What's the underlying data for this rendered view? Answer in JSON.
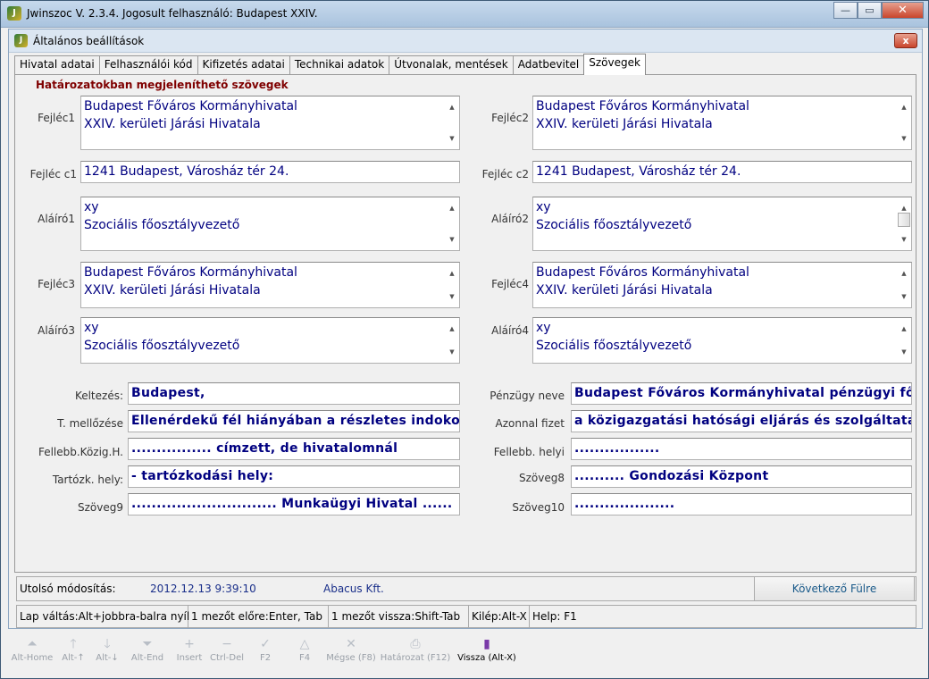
{
  "app": {
    "title": "Jwinszoc V. 2.3.4.  Jogosult felhasználó: Budapest XXIV."
  },
  "window_buttons": {
    "minimize": "—",
    "maximize": "▭",
    "close": "✕"
  },
  "dialog": {
    "title": "Általános beállítások",
    "close": "x"
  },
  "tabs": [
    {
      "label": "Hivatal adatai"
    },
    {
      "label": "Felhasználói kód"
    },
    {
      "label": "Kifizetés adatai"
    },
    {
      "label": "Technikai adatok"
    },
    {
      "label": "Útvonalak, mentések"
    },
    {
      "label": "Adatbevitel"
    },
    {
      "label": "Szövegek"
    }
  ],
  "active_tab": "Szövegek",
  "section_heading": "Határozatokban megjeleníthető szövegek",
  "fields": {
    "fejlec1": {
      "label": "Fejléc1",
      "lines": [
        "Budapest Főváros Kormányhivatal",
        "XXIV. kerületi Járási Hivatala"
      ]
    },
    "fejlec2": {
      "label": "Fejléc2",
      "lines": [
        "Budapest Főváros Kormányhivatal",
        "XXIV. kerületi Járási Hivatala"
      ]
    },
    "fejlec_c1": {
      "label": "Fejléc c1",
      "value": "1241 Budapest, Városház tér 24."
    },
    "fejlec_c2": {
      "label": "Fejléc c2",
      "value": "1241 Budapest, Városház tér 24."
    },
    "alairo1": {
      "label": "Aláíró1",
      "lines": [
        "xy",
        "Szociális főosztályvezető"
      ]
    },
    "alairo2": {
      "label": "Aláíró2",
      "lines": [
        "xy",
        "Szociális főosztályvezető"
      ]
    },
    "fejlec3": {
      "label": "Fejléc3",
      "lines": [
        "Budapest Főváros Kormányhivatal",
        "XXIV. kerületi Járási Hivatala"
      ]
    },
    "fejlec4": {
      "label": "Fejléc4",
      "lines": [
        "Budapest Főváros Kormányhivatal",
        "XXIV. kerületi Járási Hivatala"
      ]
    },
    "alairo3": {
      "label": "Aláíró3",
      "lines": [
        "xy",
        "Szociális főosztályvezető"
      ]
    },
    "alairo4": {
      "label": "Aláíró4",
      "lines": [
        "xy",
        "Szociális főosztályvezető"
      ]
    },
    "keltezes": {
      "label": "Keltezés:",
      "value": "Budapest,"
    },
    "penzugy_neve": {
      "label": "Pénzügy neve",
      "value": "Budapest Főváros Kormányhivatal pénzügyi fő"
    },
    "t_mellozese": {
      "label": "T. mellőzése",
      "value": "Ellenérdekű fél hiányában a részletes indokol"
    },
    "azonnal_fizet": {
      "label": "Azonnal fizet",
      "value": "a közigazgatási hatósági eljárás és szolgáltatá"
    },
    "fellebb_kozig": {
      "label": "Fellebb.Közig.H.",
      "value": "................  címzett, de hivatalomnál"
    },
    "fellebb_helyi": {
      "label": "Fellebb. helyi",
      "value": "................."
    },
    "tartozk_hely": {
      "label": "Tartózk. hely:",
      "value": " - tartózkodási hely:"
    },
    "szoveg8": {
      "label": "Szöveg8",
      "value": ".......... Gondozási Központ"
    },
    "szoveg9": {
      "label": "Szöveg9",
      "value": "............................. Munkaügyi Hivatal ......"
    },
    "szoveg10": {
      "label": "Szöveg10",
      "value": "...................."
    }
  },
  "status": {
    "label": "Utolsó módosítás:",
    "date": "2012.12.13 9:39:10",
    "user": "Abacus Kft."
  },
  "next_tab_button": "Következő Fülre",
  "hints": [
    "Lap váltás:Alt+jobbra-balra nyíl",
    "1 mezőt előre:Enter, Tab",
    "1 mezőt vissza:Shift-Tab",
    "Kilép:Alt-X",
    "Help: F1"
  ],
  "toolbar": [
    {
      "label": "Alt-Home",
      "icon": "first-icon"
    },
    {
      "label": "Alt-↑",
      "icon": "up-arrow-icon"
    },
    {
      "label": "Alt-↓",
      "icon": "down-arrow-icon"
    },
    {
      "label": "Alt-End",
      "icon": "last-icon"
    },
    {
      "label": "Insert",
      "icon": "plus-icon"
    },
    {
      "label": "Ctrl-Del",
      "icon": "minus-icon"
    },
    {
      "label": "F2",
      "icon": "check-icon"
    },
    {
      "label": "F4",
      "icon": "triangle-icon"
    },
    {
      "label": "Mégse (F8)",
      "icon": "cancel-icon"
    },
    {
      "label": "Határozat (F12)",
      "icon": "printer-icon"
    },
    {
      "label": "Vissza (Alt-X)",
      "icon": "exit-door-icon"
    }
  ]
}
